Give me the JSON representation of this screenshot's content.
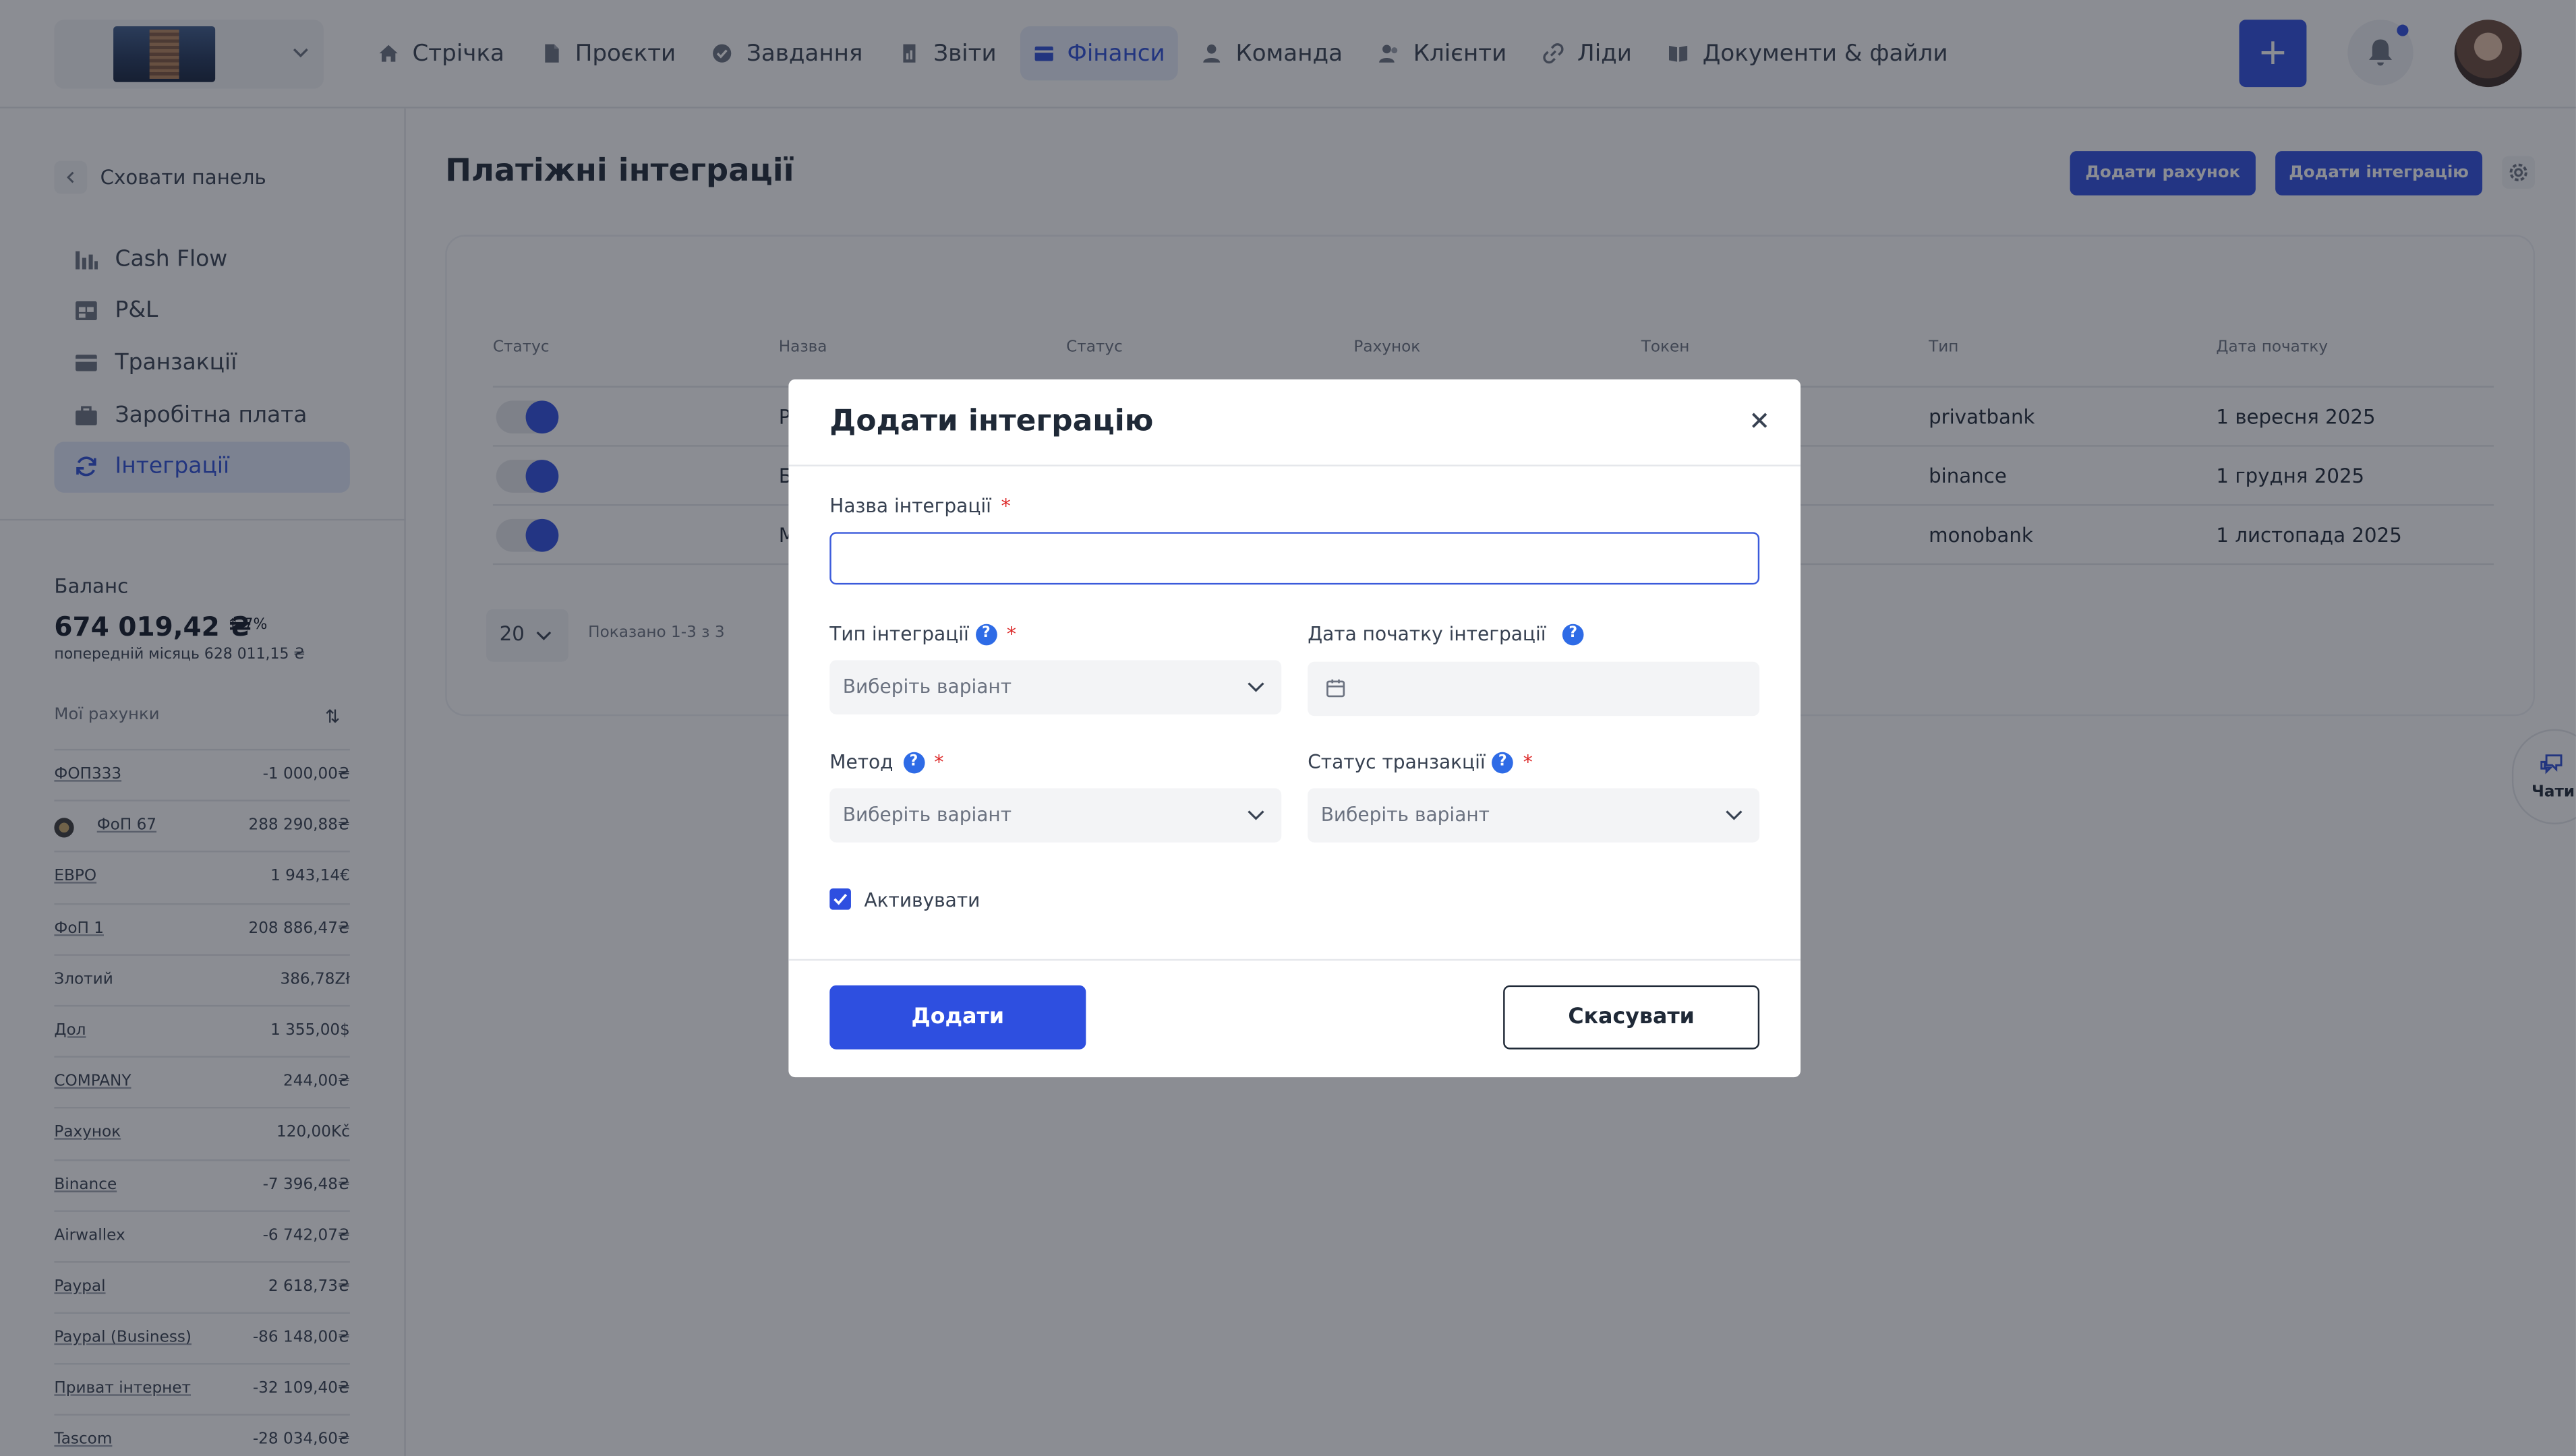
{
  "nav": {
    "items": [
      {
        "label": "Стрічка",
        "icon": "home-icon"
      },
      {
        "label": "Проєкти",
        "icon": "file-icon"
      },
      {
        "label": "Завдання",
        "icon": "check-circle-icon"
      },
      {
        "label": "Звіти",
        "icon": "report-icon"
      },
      {
        "label": "Фінанси",
        "icon": "wallet-icon",
        "active": true
      },
      {
        "label": "Команда",
        "icon": "user-icon"
      },
      {
        "label": "Клієнти",
        "icon": "users-icon"
      },
      {
        "label": "Ліди",
        "icon": "link-icon"
      },
      {
        "label": "Документи & файли",
        "icon": "book-icon"
      }
    ],
    "plus_label": "+"
  },
  "sidebar": {
    "hide_label": "Сховати панель",
    "menu": [
      {
        "label": "Cash Flow"
      },
      {
        "label": "P&L"
      },
      {
        "label": "Транзакції"
      },
      {
        "label": "Заробітна плата"
      },
      {
        "label": "Інтеграції",
        "active": true
      }
    ],
    "balance": {
      "label": "Баланс",
      "amount": "674 019,42 ₴",
      "change": "↑ 7%",
      "prev": "попередній місяць 628 011,15 ₴"
    },
    "accounts_label": "Мої рахунки",
    "sort_glyph": "⇅",
    "accounts": [
      {
        "name": "ФОП333",
        "value": "-1 000,00₴"
      },
      {
        "name": "ФоП 67",
        "value": "288 290,88₴"
      },
      {
        "name": "ЕВРО",
        "value": "1 943,14€"
      },
      {
        "name": "ФоП 1",
        "value": "208 886,47₴"
      },
      {
        "name": "Злотий",
        "value": "386,78Zł"
      },
      {
        "name": "Дол",
        "value": "1 355,00$"
      },
      {
        "name": "COMPANY",
        "value": "244,00₴"
      },
      {
        "name": "Рахунок",
        "value": "120,00Kč"
      },
      {
        "name": "Binance",
        "value": "-7 396,48₴"
      },
      {
        "name": "Airwallex",
        "value": "-6 742,07₴"
      },
      {
        "name": "Paypal",
        "value": "2 618,73₴"
      },
      {
        "name": "Paypal (Business)",
        "value": "-86 148,00₴"
      },
      {
        "name": "Приват інтернет",
        "value": "-32 109,40₴"
      },
      {
        "name": "Tascom",
        "value": "-28 034,60₴"
      }
    ]
  },
  "main": {
    "title": "Платіжні інтеграції",
    "add_account_label": "Додати рахунок",
    "add_integration_label": "Додати інтеграцію",
    "table": {
      "headers": [
        "Статус",
        "Назва",
        "Статус",
        "Рахунок",
        "Токен",
        "Тип",
        "Дата початку"
      ],
      "rows": [
        {
          "name": "P",
          "type": "privatbank",
          "date": "1 вересня 2025"
        },
        {
          "name": "Б",
          "type": "binance",
          "date": "1 грудня 2025"
        },
        {
          "name": "M",
          "type": "monobank",
          "date": "1 листопада 2025"
        }
      ]
    },
    "per_page": "20",
    "shown_text": "Показано 1-3 з 3"
  },
  "chats_label": "Чати",
  "modal": {
    "title": "Додати інтеграцію",
    "name_label": "Назва інтеграції",
    "name_value": "",
    "type_label": "Тип інтеграції",
    "type_placeholder": "Виберіть варіант",
    "date_label": "Дата початку інтеграції",
    "method_label": "Метод",
    "method_placeholder": "Виберіть варіант",
    "tx_status_label": "Статус транзакції",
    "tx_status_placeholder": "Виберіть варіант",
    "activate_label": "Активувати",
    "activate_checked": true,
    "submit_label": "Додати",
    "cancel_label": "Скасувати",
    "required_mark": "*",
    "help_glyph": "?"
  },
  "colors": {
    "primary": "#2e4fe0",
    "active_nav_bg": "#e6ecfb",
    "required": "#dc2626",
    "help": "#2e6be6"
  }
}
